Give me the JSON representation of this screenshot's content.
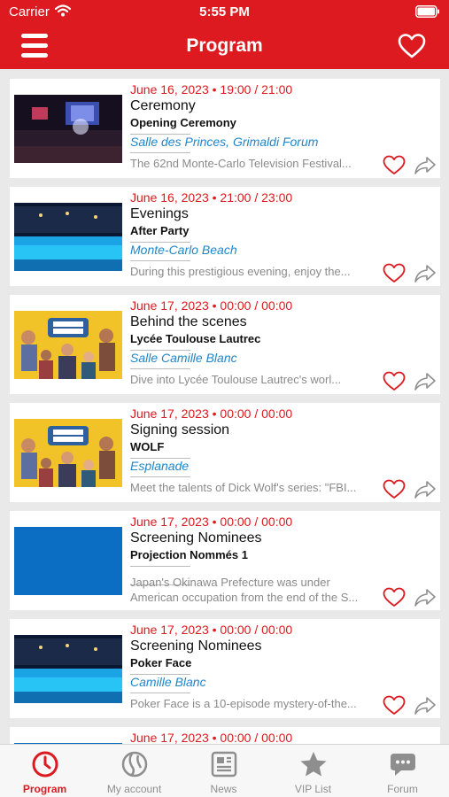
{
  "status_bar": {
    "carrier": "Carrier",
    "time": "5:55 PM"
  },
  "header": {
    "title": "Program",
    "menu_icon": "hamburger-menu-icon",
    "favorites_icon": "heart-outline-icon"
  },
  "accent_color": "#dc1a1f",
  "link_color": "#1f86c9",
  "events": [
    {
      "date": "June 16, 2023 • 19:00 / 21:00",
      "type": "Ceremony",
      "name": "Opening Ceremony",
      "venue": "Salle des Princes, Grimaldi Forum",
      "description": "The 62nd Monte-Carlo Television Festival...",
      "thumb": "stage"
    },
    {
      "date": "June 16, 2023 • 21:00 / 23:00",
      "type": "Evenings",
      "name": "After Party",
      "venue": "Monte-Carlo Beach",
      "description": "During this prestigious evening, enjoy the...",
      "thumb": "pool"
    },
    {
      "date": "June 17, 2023 • 00:00 / 00:00",
      "type": "Behind the scenes",
      "name": "Lycée Toulouse Lautrec",
      "venue": "Salle Camille Blanc",
      "description": "Dive into Lycée Toulouse Lautrec's worl...",
      "thumb": "poster"
    },
    {
      "date": "June 17, 2023 • 00:00 / 00:00",
      "type": "Signing session",
      "name": "WOLF",
      "venue": "Esplanade",
      "description": "Meet the talents of Dick Wolf's series: \"FBI...",
      "thumb": "poster"
    },
    {
      "date": "June 17, 2023 • 00:00 / 00:00",
      "type": "Screening Nominees",
      "name": "Projection Nommés 1",
      "venue": "",
      "description": "Japan's Okinawa Prefecture was under American occupation from the end of the S...",
      "thumb": "blue"
    },
    {
      "date": "June 17, 2023 • 00:00 / 00:00",
      "type": "Screening Nominees",
      "name": "Poker Face",
      "venue": "Camille Blanc",
      "description": "Poker Face is a 10-episode mystery-of-the...",
      "thumb": "pool"
    },
    {
      "date": "June 17, 2023 • 00:00 / 00:00",
      "type": "",
      "name": "",
      "venue": "",
      "description": "",
      "thumb": "blue"
    }
  ],
  "tabs": [
    {
      "label": "Program",
      "icon": "clock-icon",
      "active": true
    },
    {
      "label": "My account",
      "icon": "account-icon",
      "active": false
    },
    {
      "label": "News",
      "icon": "newspaper-icon",
      "active": false
    },
    {
      "label": "VIP List",
      "icon": "star-icon",
      "active": false
    },
    {
      "label": "Forum",
      "icon": "chat-bubble-icon",
      "active": false
    }
  ]
}
